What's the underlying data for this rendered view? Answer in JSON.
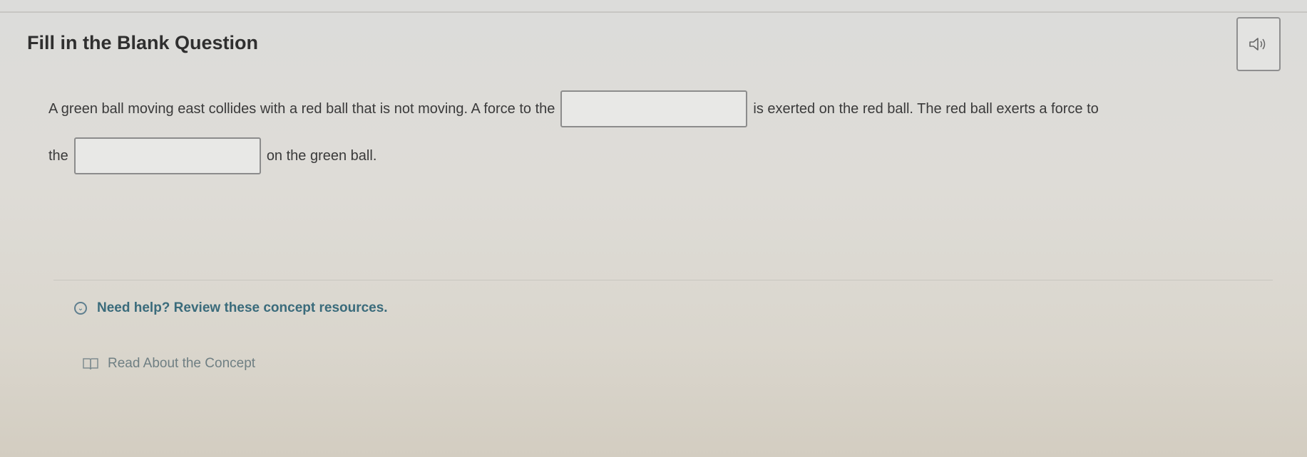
{
  "header": {
    "title": "Fill in the Blank Question",
    "audio_icon": "speaker-icon"
  },
  "question": {
    "segment_1": "A green ball moving east collides with a red ball that is not moving. A force to the",
    "blank_1_value": "",
    "segment_2": "is exerted on the red ball. The red ball exerts a force to",
    "segment_3": "the",
    "blank_2_value": "",
    "segment_4": "on the green ball."
  },
  "help": {
    "toggle_label": "Need help? Review these concept resources.",
    "toggle_icon": "chevron-down-icon",
    "resources": [
      {
        "label": "Read About the Concept",
        "icon": "book-icon"
      }
    ]
  },
  "colors": {
    "accent": "#3a6b7b",
    "link_muted": "#6f7f83",
    "title": "#2f2f2f"
  }
}
